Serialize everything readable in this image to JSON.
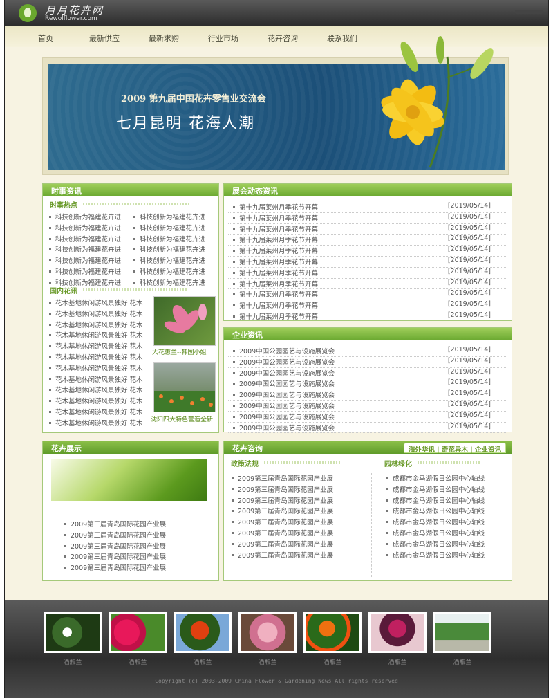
{
  "header": {
    "logo_cn": "月月花卉网",
    "logo_en": "Rewolflower.com"
  },
  "nav": [
    "首页",
    "最新供应",
    "最新求购",
    "行业市场",
    "花卉咨询",
    "联系我们"
  ],
  "banner": {
    "title": "2009 第九届中国花卉零售业交流会",
    "subtitle": "七月昆明  花海人潮"
  },
  "news": {
    "title": "时事资讯",
    "hot_title": "时事热点",
    "hot_items": [
      "科技创新为福建花卉进",
      "科技创新为福建花卉进",
      "科技创新为福建花卉进",
      "科技创新为福建花卉进",
      "科技创新为福建花卉进",
      "科技创新为福建花卉进",
      "科技创新为福建花卉进"
    ],
    "domestic_title": "国内花讯",
    "domestic_items": [
      "花木基地休闲游风景独好 花木",
      "花木基地休闲游风景独好 花木",
      "花木基地休闲游风景独好 花木",
      "花木基地休闲游风景独好 花木",
      "花木基地休闲游风景独好 花木",
      "花木基地休闲游风景独好 花木",
      "花木基地休闲游风景独好 花木",
      "花木基地休闲游风景独好 花木",
      "花木基地休闲游风景独好 花木",
      "花木基地休闲游风景独好 花木",
      "花木基地休闲游风景独好 花木",
      "花木基地休闲游风景独好 花木"
    ],
    "photo1_caption": "大花蕙兰--韩国小姐",
    "photo2_caption": "沈阳四大特色营造全新"
  },
  "expo": {
    "title": "展会动态资讯",
    "items": [
      "第十九届莱州月季花节开幕",
      "第十九届莱州月季花节开幕",
      "第十九届莱州月季花节开幕",
      "第十九届莱州月季花节开幕",
      "第十九届莱州月季花节开幕",
      "第十九届莱州月季花节开幕",
      "第十九届莱州月季花节开幕",
      "第十九届莱州月季花节开幕",
      "第十九届莱州月季花节开幕",
      "第十九届莱州月季花节开幕",
      "第十九届莱州月季花节开幕"
    ],
    "date": "[2019/05/14]"
  },
  "enterprise": {
    "title": "企业资讯",
    "items": [
      "2009中国公园园艺与设施展览会",
      "2009中国公园园艺与设施展览会",
      "2009中国公园园艺与设施展览会",
      "2009中国公园园艺与设施展览会",
      "2009中国公园园艺与设施展览会",
      "2009中国公园园艺与设施展览会",
      "2009中国公园园艺与设施展览会",
      "2009中国公园园艺与设施展览会"
    ],
    "date": "[2019/05/14]"
  },
  "showcase": {
    "title": "花卉展示",
    "items": [
      "2009第三届青岛国际花园产业展",
      "2009第三届青岛国际花园产业展",
      "2009第三届青岛国际花园产业展",
      "2009第三届青岛国际花园产业展",
      "2009第三届青岛国际花园产业展"
    ]
  },
  "consult": {
    "title": "花卉咨询",
    "tabs": "海外华讯 | 奇花异木 | 企业资讯",
    "policy_title": "政策法规",
    "policy_items": [
      "2009第三届青岛国际花园产业展",
      "2009第三届青岛国际花园产业展",
      "2009第三届青岛国际花园产业展",
      "2009第三届青岛国际花园产业展",
      "2009第三届青岛国际花园产业展",
      "2009第三届青岛国际花园产业展",
      "2009第三届青岛国际花园产业展",
      "2009第三届青岛国际花园产业展"
    ],
    "garden_title": "园林绿化",
    "garden_items": [
      "成都市金马湖假日公园中心轴线",
      "成都市金马湖假日公园中心轴线",
      "成都市金马湖假日公园中心轴线",
      "成都市金马湖假日公园中心轴线",
      "成都市金马湖假日公园中心轴线",
      "成都市金马湖假日公园中心轴线",
      "成都市金马湖假日公园中心轴线",
      "成都市金马湖假日公园中心轴线"
    ]
  },
  "gallery": {
    "captions": [
      "酒瓶兰",
      "酒瓶兰",
      "酒瓶兰",
      "酒瓶兰",
      "酒瓶兰",
      "酒瓶兰",
      "酒瓶兰"
    ],
    "copyright": "Copyright (c) 2003-2009 China Flower & Gardening News All rights reserved"
  }
}
